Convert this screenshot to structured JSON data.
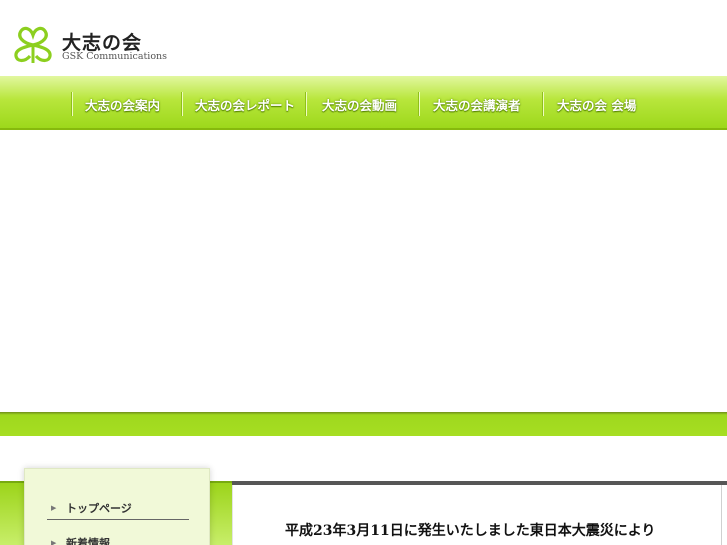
{
  "site": {
    "title": "大志の会",
    "subtitle": "GSK Communications",
    "logo_icon": "clover-icon",
    "accent_color": "#9dd81b"
  },
  "nav": {
    "items": [
      {
        "label": "大志の会案内"
      },
      {
        "label": "大志の会レポート"
      },
      {
        "label": "大志の会動画"
      },
      {
        "label": "大志の会講演者"
      },
      {
        "label": "大志の会 会場"
      }
    ]
  },
  "sidebar": {
    "items": [
      {
        "label": "トップページ"
      },
      {
        "label": "新着情報"
      }
    ]
  },
  "main": {
    "lead_text": "平成23年3月11日に発生いたしました東日本大震災により"
  }
}
